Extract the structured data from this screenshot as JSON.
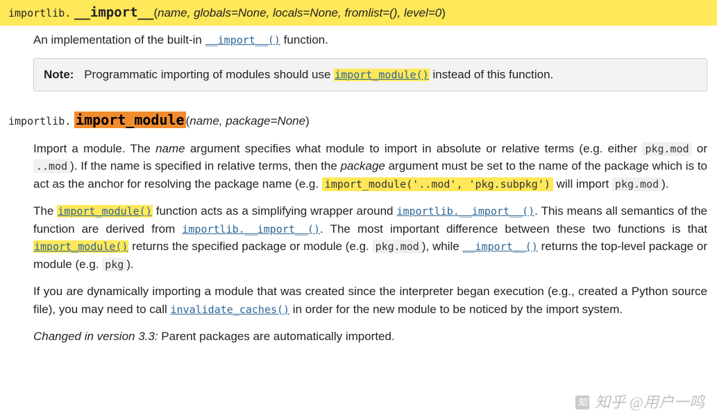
{
  "sig1": {
    "prefix": "importlib.",
    "name": "__import__",
    "open": "(",
    "params": "name, globals=None, locals=None, fromlist=(), level=0",
    "close": ")"
  },
  "sig1_desc": {
    "t1": "An implementation of the built-in ",
    "link": "__import__()",
    "t2": " function."
  },
  "note": {
    "label": "Note:",
    "t1": "Programmatic importing of modules should use ",
    "link": "import_module()",
    "t2": " instead of this function."
  },
  "sig2": {
    "prefix": "importlib.",
    "name": "import_module",
    "open": "(",
    "params": "name, package=None",
    "close": ")"
  },
  "p1": {
    "t1": "Import a module. The ",
    "i1": "name",
    "t2": " argument specifies what module to import in absolute or relative terms (e.g. either ",
    "c1": "pkg.mod",
    "t3": " or ",
    "c2": "..mod",
    "t4": "). If the name is specified in relative terms, then the ",
    "i2": "package",
    "t5": " argument must be set to the name of the package which is to act as the anchor for resolving the package name (e.g. ",
    "c3": "import_module('..mod', 'pkg.subpkg')",
    "t6": " will import ",
    "c4": "pkg.mod",
    "t7": ")."
  },
  "p2": {
    "t1": "The ",
    "l1": "import_module()",
    "t2": " function acts as a simplifying wrapper around ",
    "l2": "importlib.__import__()",
    "t3": ". This means all semantics of the function are derived from ",
    "l3": "importlib.__import__()",
    "t4": ". The most important difference between these two functions is that ",
    "l4": "import_module()",
    "t5": " returns the specified package or module (e.g. ",
    "c1": "pkg.mod",
    "t6": "), while ",
    "l5": "__import__()",
    "t7": " returns the top-level package or module (e.g. ",
    "c2": "pkg",
    "t8": ")."
  },
  "p3": {
    "t1": "If you are dynamically importing a module that was created since the interpreter began execution (e.g., created a Python source file), you may need to call ",
    "l1": "invalidate_caches()",
    "t2": " in order for the new module to be noticed by the import system."
  },
  "p4": {
    "i1": "Changed in version 3.3:",
    "t1": " Parent packages are automatically imported."
  },
  "watermark": "知乎 @用户一鸣"
}
